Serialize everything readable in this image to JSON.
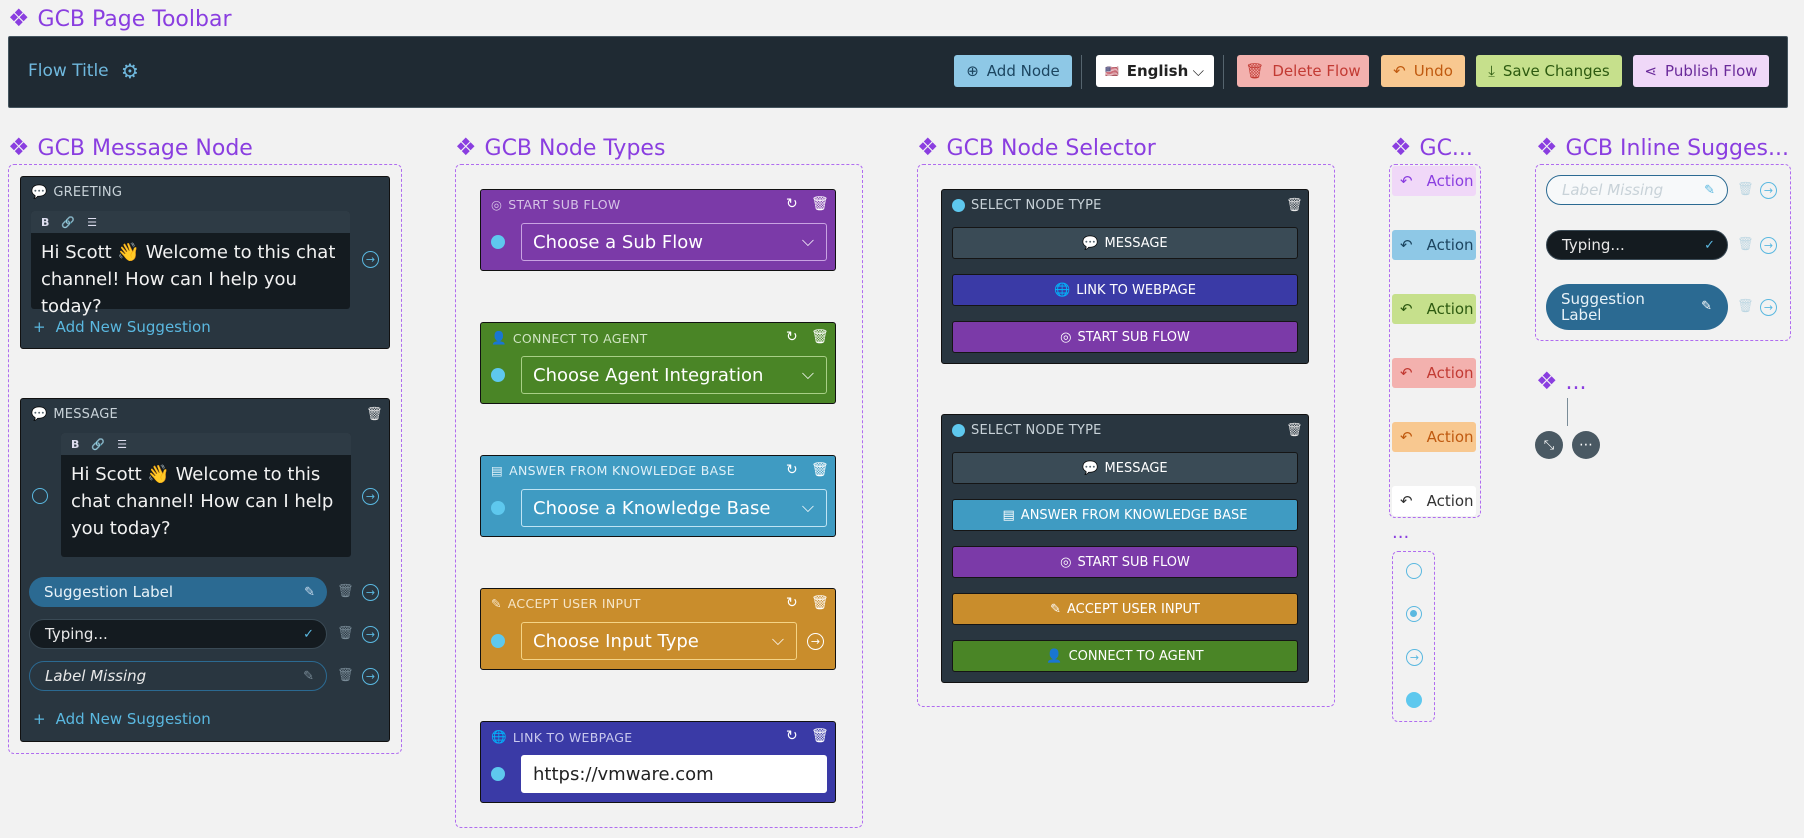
{
  "sections": {
    "toolbar": "GCB Page Toolbar",
    "message_node": "GCB Message Node",
    "node_types": "GCB Node Types",
    "node_selector": "GCB Node Selector",
    "actions": "GC...",
    "inline": "GCB Inline Sugges...",
    "misc": "...",
    "dots": "..."
  },
  "toolbar": {
    "flow_title": "Flow Title",
    "add_node": "Add Node",
    "language": "English",
    "delete_flow": "Delete Flow",
    "undo": "Undo",
    "save_changes": "Save Changes",
    "publish_flow": "Publish Flow"
  },
  "message_node": {
    "greeting_header": "GREETING",
    "greeting_text": "Hi Scott 👋 Welcome to this chat channel! How can I help you today?",
    "add_suggestion": "Add New Suggestion",
    "message_header": "MESSAGE",
    "message_text": "Hi Scott 👋 Welcome to this chat channel! How can I help you today?",
    "suggestion_label": "Suggestion Label",
    "typing": "Typing...",
    "label_missing": "Label Missing",
    "add_suggestion_2": "Add New Suggestion"
  },
  "node_types": [
    {
      "header": "START SUB FLOW",
      "value": "Choose a Sub Flow",
      "color": "#7b3aa8"
    },
    {
      "header": "CONNECT TO AGENT",
      "value": "Choose Agent Integration",
      "color": "#4a8526"
    },
    {
      "header": "ANSWER FROM KNOWLEDGE BASE",
      "value": "Choose a Knowledge Base",
      "color": "#3f9bc2"
    },
    {
      "header": "ACCEPT USER INPUT",
      "value": "Choose Input Type",
      "color": "#c98d2c"
    },
    {
      "header": "LINK TO WEBPAGE",
      "value": "https://vmware.com",
      "color": "#3a3aa6"
    }
  ],
  "node_selector": {
    "header1": "SELECT NODE TYPE",
    "options1": [
      "MESSAGE",
      "LINK TO WEBPAGE",
      "START SUB FLOW"
    ],
    "header2": "SELECT NODE TYPE",
    "options2": [
      "MESSAGE",
      "ANSWER FROM KNOWLEDGE BASE",
      "START SUB FLOW",
      "ACCEPT USER INPUT",
      "CONNECT TO AGENT"
    ]
  },
  "actions": [
    "Action",
    "Action",
    "Action",
    "Action",
    "Action",
    "Action"
  ],
  "inline": {
    "label_missing": "Label Missing",
    "typing": "Typing...",
    "suggestion_label": "Suggestion Label"
  }
}
